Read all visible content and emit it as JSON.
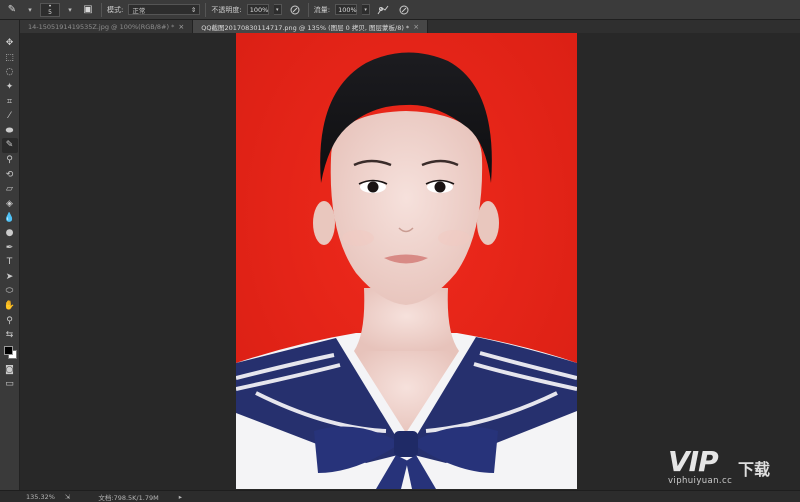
{
  "options_bar": {
    "brush_size": "5",
    "mode_label": "模式:",
    "mode_value": "正常",
    "opacity_label": "不透明度:",
    "opacity_value": "100%",
    "flow_label": "流量:",
    "flow_value": "100%"
  },
  "tabs": [
    {
      "label": "14-1505191419535Z.jpg @ 100%(RGB/8#) *",
      "active": false
    },
    {
      "label": "QQ截图20170830114717.png @ 135% (图层 0 拷贝, 图层蒙板/8) *",
      "active": true
    }
  ],
  "status_bar": {
    "zoom": "135.32%",
    "doc_label": "文档:798.5K/1.79M",
    "arrow": "▸"
  },
  "watermark": {
    "logo": "VIP",
    "subtitle": "下载",
    "url": "viphuiyuan.cc"
  },
  "colors": {
    "photo_background": "#e8251a",
    "uniform_navy": "#26306e",
    "panel": "#3a3a3a",
    "workspace": "#282828"
  }
}
